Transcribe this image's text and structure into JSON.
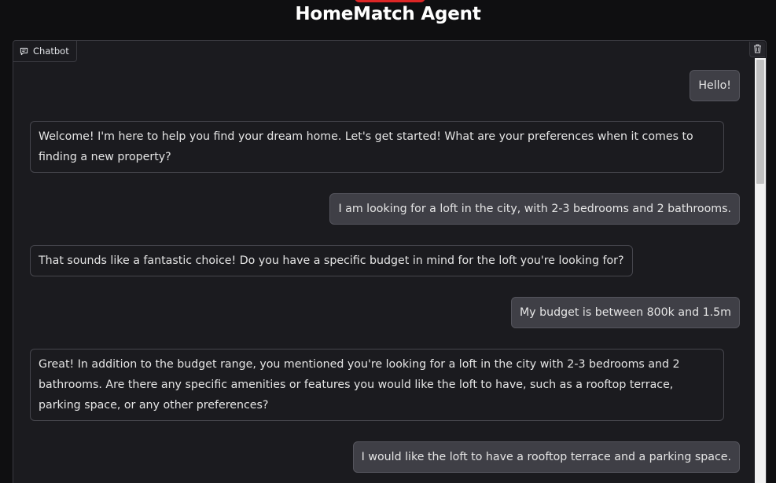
{
  "app": {
    "title": "HomeMatch Agent"
  },
  "chatbot": {
    "label": "Chatbot",
    "label_icon": "chat-bubble-icon",
    "clear_icon": "trash-icon",
    "messages": [
      {
        "role": "user",
        "text": "Hello!"
      },
      {
        "role": "bot",
        "text": "Welcome! I'm here to help you find your dream home. Let's get started! What are your preferences when it comes to finding a new property?"
      },
      {
        "role": "user",
        "text": "I am looking for a loft in the city, with 2-3 bedrooms and 2 bathrooms."
      },
      {
        "role": "bot",
        "text": "That sounds like a fantastic choice! Do you have a specific budget in mind for the loft you're looking for?"
      },
      {
        "role": "user",
        "text": "My budget is between 800k and 1.5m"
      },
      {
        "role": "bot",
        "text": "Great! In addition to the budget range, you mentioned you're looking for a loft in the city with 2-3 bedrooms and 2 bathrooms. Are there any specific amenities or features you would like the loft to have, such as a rooftop terrace, parking space, or any other preferences?"
      },
      {
        "role": "user",
        "text": "I would like the loft to have a rooftop terrace and a parking space."
      }
    ]
  },
  "colors": {
    "page_background": "#0f0f11",
    "panel_background": "#1b1b1f",
    "user_bubble": "#3f3f46",
    "accent": "#dc2626"
  }
}
